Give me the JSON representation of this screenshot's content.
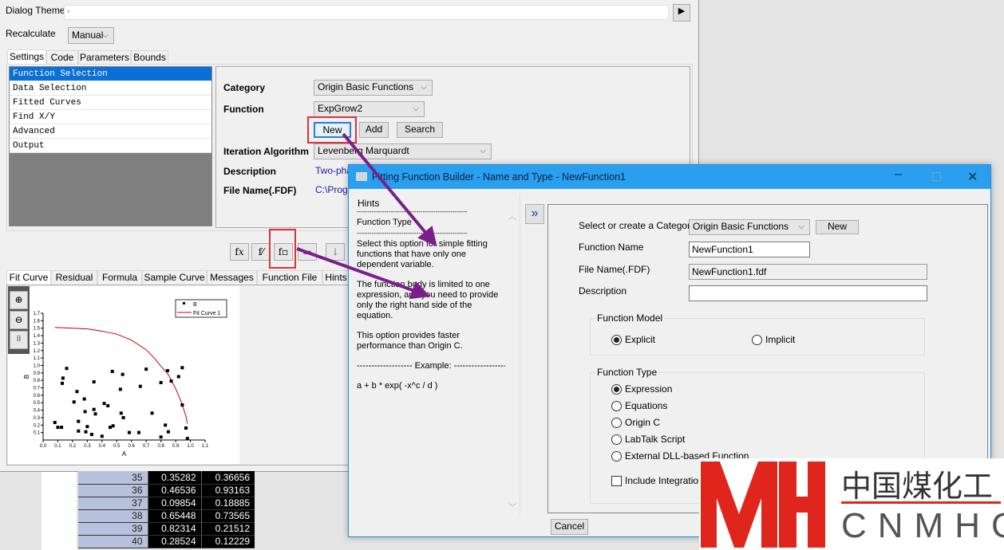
{
  "main_dialog": {
    "dialog_theme_label": "Dialog Theme",
    "dialog_theme_value": "*",
    "theme_button": "▶",
    "recalculate_label": "Recalculate",
    "recalculate_value": "Manual",
    "tabs": [
      "Settings",
      "Code",
      "Parameters",
      "Bounds"
    ],
    "tree_items": [
      "Function Selection",
      "Data Selection",
      "Fitted Curves",
      "Find X/Y",
      "Advanced",
      "Output"
    ],
    "category_label": "Category",
    "category_value": "Origin Basic Functions",
    "function_label": "Function",
    "function_value": "ExpGrow2",
    "new_button": "New",
    "add_button": "Add",
    "search_button": "Search",
    "iteration_label": "Iteration Algorithm",
    "iteration_value": "Levenberg Marquardt",
    "description_label": "Description",
    "description_value": "Two-pha",
    "filename_label": "File Name(.FDF)",
    "filename_value": "C:\\Progr",
    "bottom_tabs": [
      "Fit Curve",
      "Residual",
      "Formula",
      "Sample Curve",
      "Messages",
      "Function File",
      "Hints"
    ]
  },
  "chart_data": {
    "type": "scatter",
    "xlabel": "A",
    "ylabel": "B",
    "xlim": [
      0,
      1.1
    ],
    "ylim": [
      0,
      1.7
    ],
    "xticks": [
      "0.0",
      "0.1",
      "0.2",
      "0.3",
      "0.4",
      "0.5",
      "0.6",
      "0.7",
      "0.8",
      "0.9",
      "1.0",
      "1.1"
    ],
    "yticks": [
      "0.1",
      "0.2",
      "0.3",
      "0.4",
      "0.5",
      "0.6",
      "0.7",
      "0.8",
      "0.9",
      "1.0",
      "1.1",
      "1.2",
      "1.3",
      "1.4",
      "1.5",
      "1.6",
      "1.7"
    ],
    "legend": [
      "B",
      "Fit Curve 1"
    ],
    "legend_position": "top-right",
    "series": [
      {
        "name": "B",
        "kind": "scatter",
        "color": "#000000",
        "points": [
          [
            0.08,
            0.235
          ],
          [
            0.1,
            0.17
          ],
          [
            0.125,
            0.17
          ],
          [
            0.16,
            0.96
          ],
          [
            0.135,
            0.83
          ],
          [
            0.13,
            0.76
          ],
          [
            0.23,
            0.65
          ],
          [
            0.21,
            0.51
          ],
          [
            0.28,
            0.55
          ],
          [
            0.285,
            0.38
          ],
          [
            0.24,
            0.25
          ],
          [
            0.24,
            0.12
          ],
          [
            0.29,
            0.11
          ],
          [
            0.3,
            0.18
          ],
          [
            0.33,
            0.075
          ],
          [
            0.345,
            0.78
          ],
          [
            0.345,
            0.41
          ],
          [
            0.355,
            0.35
          ],
          [
            0.4,
            0.05
          ],
          [
            0.415,
            0.49
          ],
          [
            0.44,
            0.46
          ],
          [
            0.455,
            0.17
          ],
          [
            0.475,
            0.19
          ],
          [
            0.47,
            0.92
          ],
          [
            0.525,
            0.68
          ],
          [
            0.54,
            0.88
          ],
          [
            0.53,
            0.36
          ],
          [
            0.545,
            0.3
          ],
          [
            0.585,
            0.1
          ],
          [
            0.65,
            0.1
          ],
          [
            0.66,
            0.72
          ],
          [
            0.7,
            0.95
          ],
          [
            0.74,
            0.36
          ],
          [
            0.8,
            0.04
          ],
          [
            0.8,
            0.77
          ],
          [
            0.83,
            0.2
          ],
          [
            0.845,
            0.93
          ],
          [
            0.85,
            0.11
          ],
          [
            0.87,
            0.79
          ],
          [
            0.92,
            0.85
          ],
          [
            0.945,
            0.97
          ],
          [
            0.945,
            0.47
          ],
          [
            0.97,
            0.16
          ],
          [
            0.98,
            0.02
          ]
        ]
      },
      {
        "name": "Fit Curve 1",
        "kind": "line",
        "color": "#c00000",
        "points": [
          [
            0.08,
            1.51
          ],
          [
            0.2,
            1.5
          ],
          [
            0.3,
            1.49
          ],
          [
            0.4,
            1.46
          ],
          [
            0.5,
            1.42
          ],
          [
            0.6,
            1.34
          ],
          [
            0.7,
            1.21
          ],
          [
            0.75,
            1.11
          ],
          [
            0.8,
            0.99
          ],
          [
            0.85,
            0.88
          ],
          [
            0.9,
            0.69
          ],
          [
            0.94,
            0.5
          ],
          [
            0.97,
            0.32
          ],
          [
            0.98,
            0.22
          ]
        ]
      }
    ]
  },
  "worksheet": {
    "rows": [
      [
        "35",
        "0.35282",
        "0.36656"
      ],
      [
        "36",
        "0.46536",
        "0.93163"
      ],
      [
        "37",
        "0.09854",
        "0.18885"
      ],
      [
        "38",
        "0.65448",
        "0.73565"
      ],
      [
        "39",
        "0.82314",
        "0.21512"
      ],
      [
        "40",
        "0.28524",
        "0.12229"
      ]
    ]
  },
  "builder": {
    "title": "Fitting Function Builder - Name and Type - NewFunction1",
    "hints_label": "Hints",
    "hint_rule": "----------------------------------------------------",
    "hint_heading": "Function Type",
    "hint_p1": "Select this option for simple fitting functions that have only one dependent variable.",
    "hint_p2": "The function body is limited to one expression, and you need to provide only the right hand side of the equation.",
    "hint_p3": "This option provides faster performance than Origin C.",
    "hint_example": "------------------- Example: -------------------",
    "hint_formula": "a + b * exp( -x^c / d )",
    "expand_button": "»",
    "category_label": "Select or create a Category",
    "category_value": "Origin Basic Functions",
    "new_button": "New",
    "name_label": "Function Name",
    "name_value": "NewFunction1",
    "file_label": "File Name(.FDF)",
    "file_value": "NewFunction1.fdf",
    "description_label": "Description",
    "description_value": "",
    "model_group": "Function Model",
    "model_options": [
      "Explicit",
      "Implicit"
    ],
    "model_selected": "Explicit",
    "type_group": "Function Type",
    "type_options": [
      "Expression",
      "Equations",
      "Origin C",
      "LabTalk Script",
      "External DLL-based Function"
    ],
    "type_selected": "Expression",
    "include_integration": "Include Integration D",
    "cancel_button": "Cancel"
  },
  "watermark": {
    "cn": "中国煤化工",
    "en": "CNMHG",
    "mark": "MH"
  }
}
